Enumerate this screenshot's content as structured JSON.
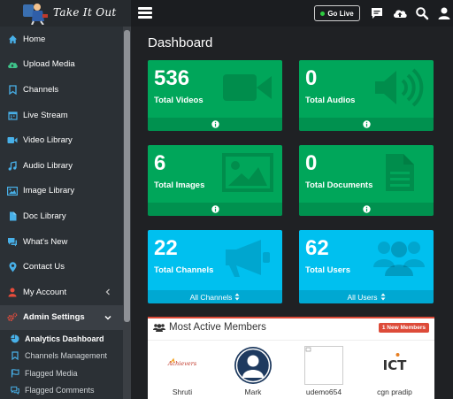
{
  "app": {
    "logo_text": "Take It Out"
  },
  "topbar": {
    "go_live_label": "Go Live"
  },
  "sidebar": {
    "items": [
      {
        "label": "Home",
        "icon": "home-icon"
      },
      {
        "label": "Upload Media",
        "icon": "cloud-upload-icon"
      },
      {
        "label": "Channels",
        "icon": "bookmark-icon"
      },
      {
        "label": "Live Stream",
        "icon": "calendar-icon"
      },
      {
        "label": "Video Library",
        "icon": "video-camera-icon"
      },
      {
        "label": "Audio Library",
        "icon": "music-icon"
      },
      {
        "label": "Image Library",
        "icon": "image-icon"
      },
      {
        "label": "Doc Library",
        "icon": "file-icon"
      },
      {
        "label": "What's New",
        "icon": "chat-icon"
      },
      {
        "label": "Contact Us",
        "icon": "map-marker-icon"
      },
      {
        "label": "My Account",
        "icon": "user-icon"
      },
      {
        "label": "Admin Settings",
        "icon": "cogs-icon"
      }
    ],
    "subitems": [
      {
        "label": "Analytics Dashboard",
        "icon": "pie-chart-icon"
      },
      {
        "label": "Channels Management",
        "icon": "bookmark-icon"
      },
      {
        "label": "Flagged Media",
        "icon": "flag-icon"
      },
      {
        "label": "Flagged Comments",
        "icon": "comments-icon"
      }
    ]
  },
  "main": {
    "title": "Dashboard",
    "cards": [
      {
        "value": "536",
        "label": "Total Videos",
        "footer": ""
      },
      {
        "value": "0",
        "label": "Total Audios",
        "footer": ""
      },
      {
        "value": "6",
        "label": "Total Images",
        "footer": ""
      },
      {
        "value": "0",
        "label": "Total Documents",
        "footer": ""
      },
      {
        "value": "22",
        "label": "Total Channels",
        "footer": "All Channels"
      },
      {
        "value": "62",
        "label": "Total Users",
        "footer": "All Users"
      }
    ],
    "members": {
      "title": "Most Active Members",
      "badge": "1 New Members",
      "list": [
        {
          "name": "Shruti",
          "logo_text": "Achievers"
        },
        {
          "name": "Mark"
        },
        {
          "name": "udemo654"
        },
        {
          "name": "cgn pradip",
          "logo_text": "ICT"
        }
      ]
    }
  },
  "colors": {
    "green": "#00a65a",
    "blue": "#00c0ef",
    "red": "#dd4b39",
    "sidebar": "#2b3035",
    "main": "#1f2124"
  }
}
